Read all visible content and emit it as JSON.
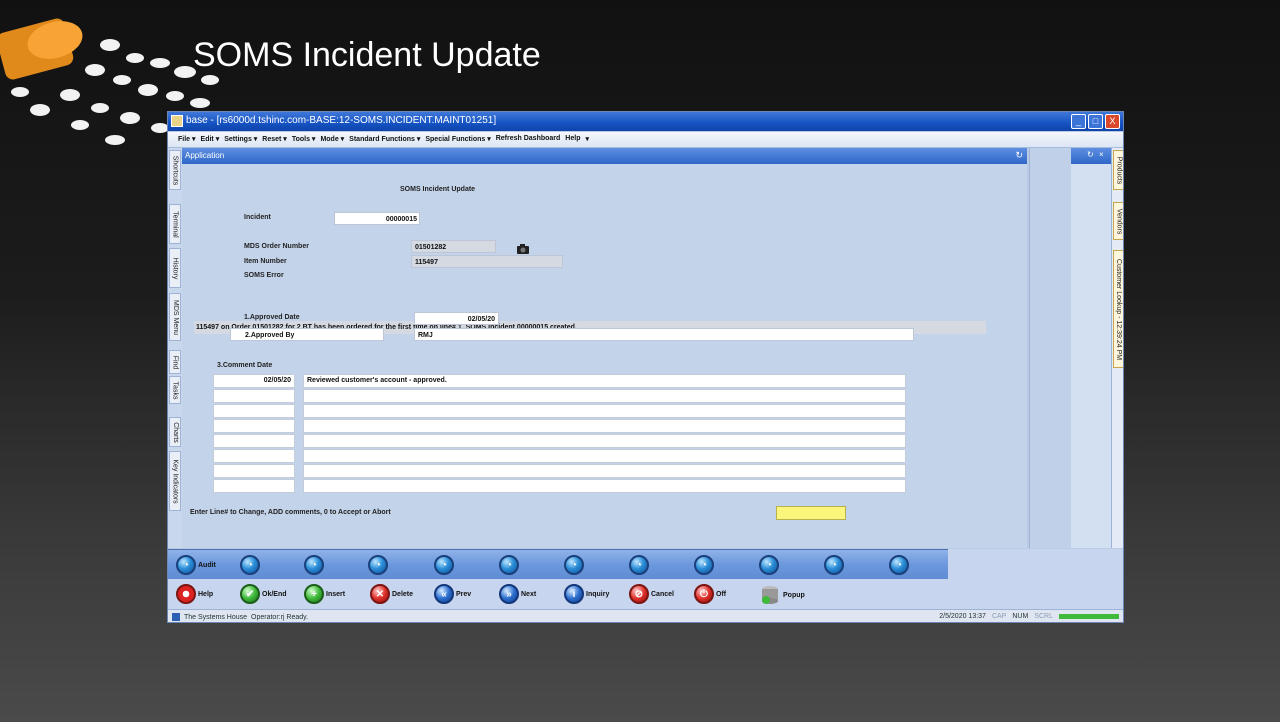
{
  "slide": {
    "title": "SOMS Incident Update"
  },
  "window": {
    "title": "base - [rs6000d.tshinc.com-BASE:12-SOMS.INCIDENT.MAINT01251]",
    "btn_min": "_",
    "btn_max": "□",
    "btn_close": "X"
  },
  "menu": {
    "file": "File ▾",
    "edit": "Edit ▾",
    "settings": "Settings ▾",
    "reset": "Reset ▾",
    "tools": "Tools ▾",
    "mode": "Mode ▾",
    "standard": "Standard Functions ▾",
    "special": "Special Functions ▾",
    "refresh": "Refresh Dashboard",
    "help": "Help",
    "more": "▾"
  },
  "left_tabs": {
    "shortcuts": "Shortcuts",
    "terminal": "Terminal",
    "history": "History",
    "mds_menu": "MDS Menu",
    "find": "Find",
    "tasks": "Tasks",
    "charts": "Charts",
    "key_indicators": "Key Indicators"
  },
  "right_tabs": {
    "products": "Products",
    "vendors": "Vendors",
    "customer_lookup": "Customer Lookup - 12:39:24 PM"
  },
  "app": {
    "title": "Application",
    "pin": "↻",
    "form_title": "SOMS Incident Update",
    "incident_label": "Incident",
    "incident_value": "00000015",
    "mds_order_label": "MDS Order Number",
    "mds_order_value": "01501282",
    "item_label": "Item Number",
    "item_value": "115497",
    "soms_error_label": "SOMS Error",
    "soms_error_text": "115497 on Order 01501282 for 2 BT has been ordered for the first time on line# 1. SOMS Incident 00000015 created.",
    "approved_date_label": "1.Approved Date",
    "approved_date_value": "02/05/20",
    "approved_by_label": "2.Approved By",
    "approved_by_value": "RMJ",
    "comment_date_label": "3.Comment Date",
    "comments": [
      {
        "date": "02/05/20",
        "text": "Reviewed customer's account - approved."
      },
      {
        "date": "",
        "text": ""
      },
      {
        "date": "",
        "text": ""
      },
      {
        "date": "",
        "text": ""
      },
      {
        "date": "",
        "text": ""
      },
      {
        "date": "",
        "text": ""
      },
      {
        "date": "",
        "text": ""
      },
      {
        "date": "",
        "text": ""
      }
    ],
    "prompt": "Enter Line# to Change, ADD comments, 0 to Accept or Abort",
    "prompt_input": ""
  },
  "rpanel": {
    "pin": "↻",
    "close": "×"
  },
  "toolbar1": {
    "audit": "Audit"
  },
  "toolbar2": {
    "help": "Help",
    "ok_end": "Ok/End",
    "insert": "Insert",
    "delete": "Delete",
    "prev": "Prev",
    "next": "Next",
    "inquiry": "Inquiry",
    "cancel": "Cancel",
    "off": "Off",
    "popup": "Popup"
  },
  "status": {
    "company": "The Systems House",
    "operator": "Operator:rj Ready.",
    "datetime": "2/5/2020 13:37",
    "cap": "CAP",
    "num": "NUM",
    "scrl": "SCRL"
  }
}
